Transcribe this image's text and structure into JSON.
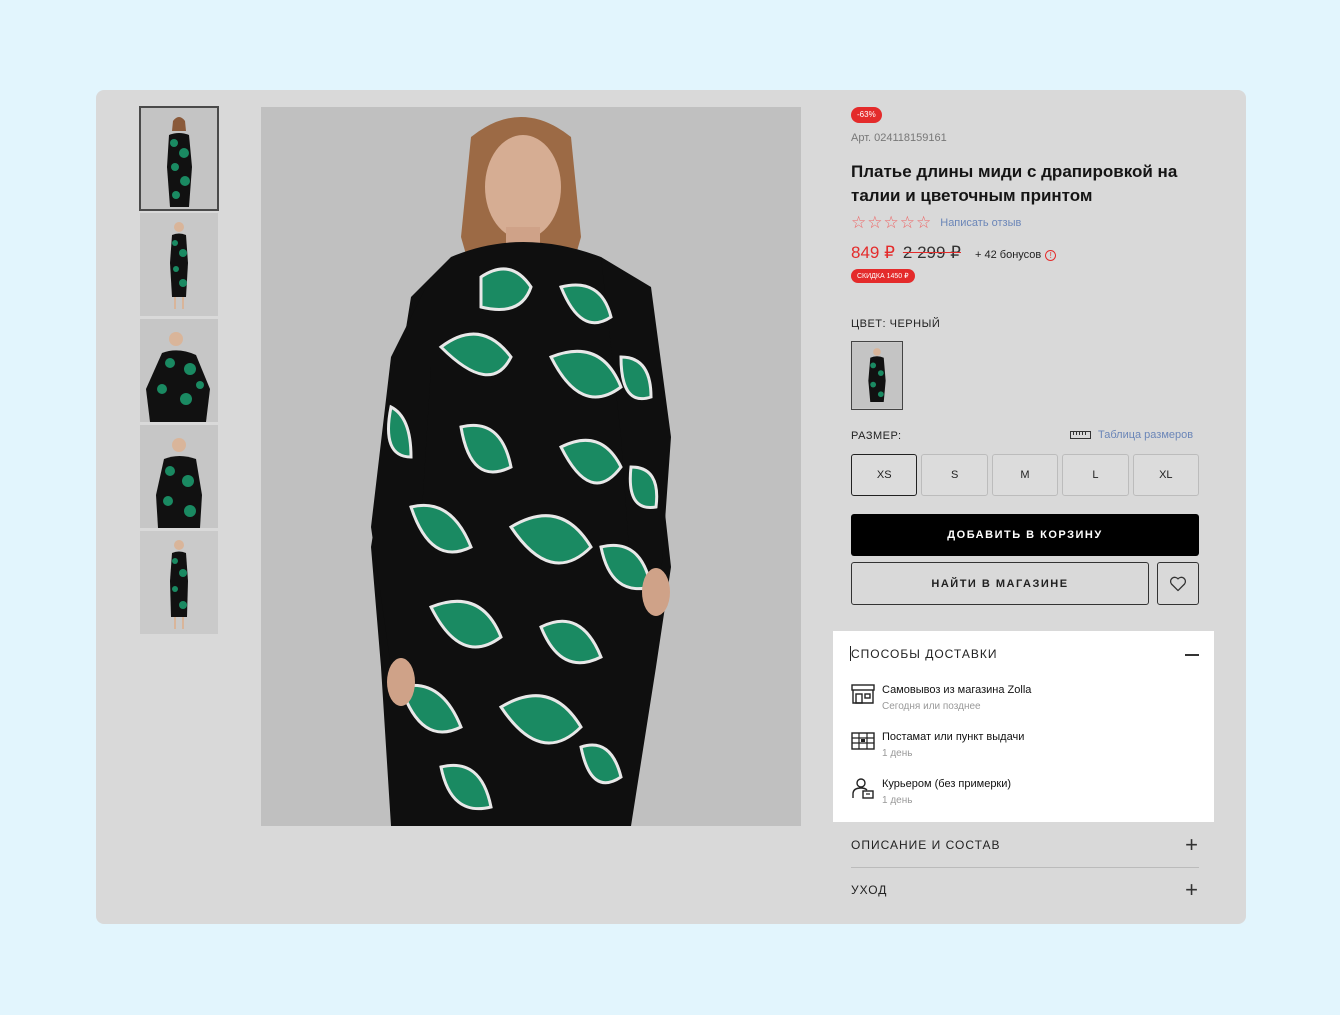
{
  "product": {
    "badge": "-63%",
    "sku": "Арт. 024118159161",
    "title": "Платье длины миди с драпировкой на талии и цветочным принтом",
    "review_link": "Написать отзыв",
    "rating_stars": 0,
    "price_new": "849 ₽",
    "price_old": "2 299 ₽",
    "bonus": "+ 42 бонусов",
    "discount": "СКИДКА 1450 ₽"
  },
  "color": {
    "label": "ЦВЕТ: ЧЕРНЫЙ"
  },
  "size": {
    "label": "РАЗМЕР:",
    "table_link": "Таблица размеров",
    "options": [
      "XS",
      "S",
      "M",
      "L",
      "XL"
    ],
    "selected": "XS"
  },
  "actions": {
    "add_to_cart": "ДОБАВИТЬ В КОРЗИНУ",
    "find_in_store": "НАЙТИ В МАГАЗИНЕ"
  },
  "delivery": {
    "heading": "СПОСОБЫ ДОСТАВКИ",
    "options": [
      {
        "title": "Самовывоз из магазина Zolla",
        "subtitle": "Сегодня или позднее",
        "icon": "store-icon"
      },
      {
        "title": "Постамат или пункт выдачи",
        "subtitle": "1 день",
        "icon": "parcel-locker-icon"
      },
      {
        "title": "Курьером (без примерки)",
        "subtitle": "1 день",
        "icon": "courier-icon"
      }
    ]
  },
  "accordion": {
    "description": "ОПИСАНИЕ И СОСТАВ",
    "care": "УХОД"
  },
  "colors": {
    "accent_red": "#e42b2b",
    "link_blue": "#6b86b8",
    "dress_green": "#1a8a62"
  }
}
